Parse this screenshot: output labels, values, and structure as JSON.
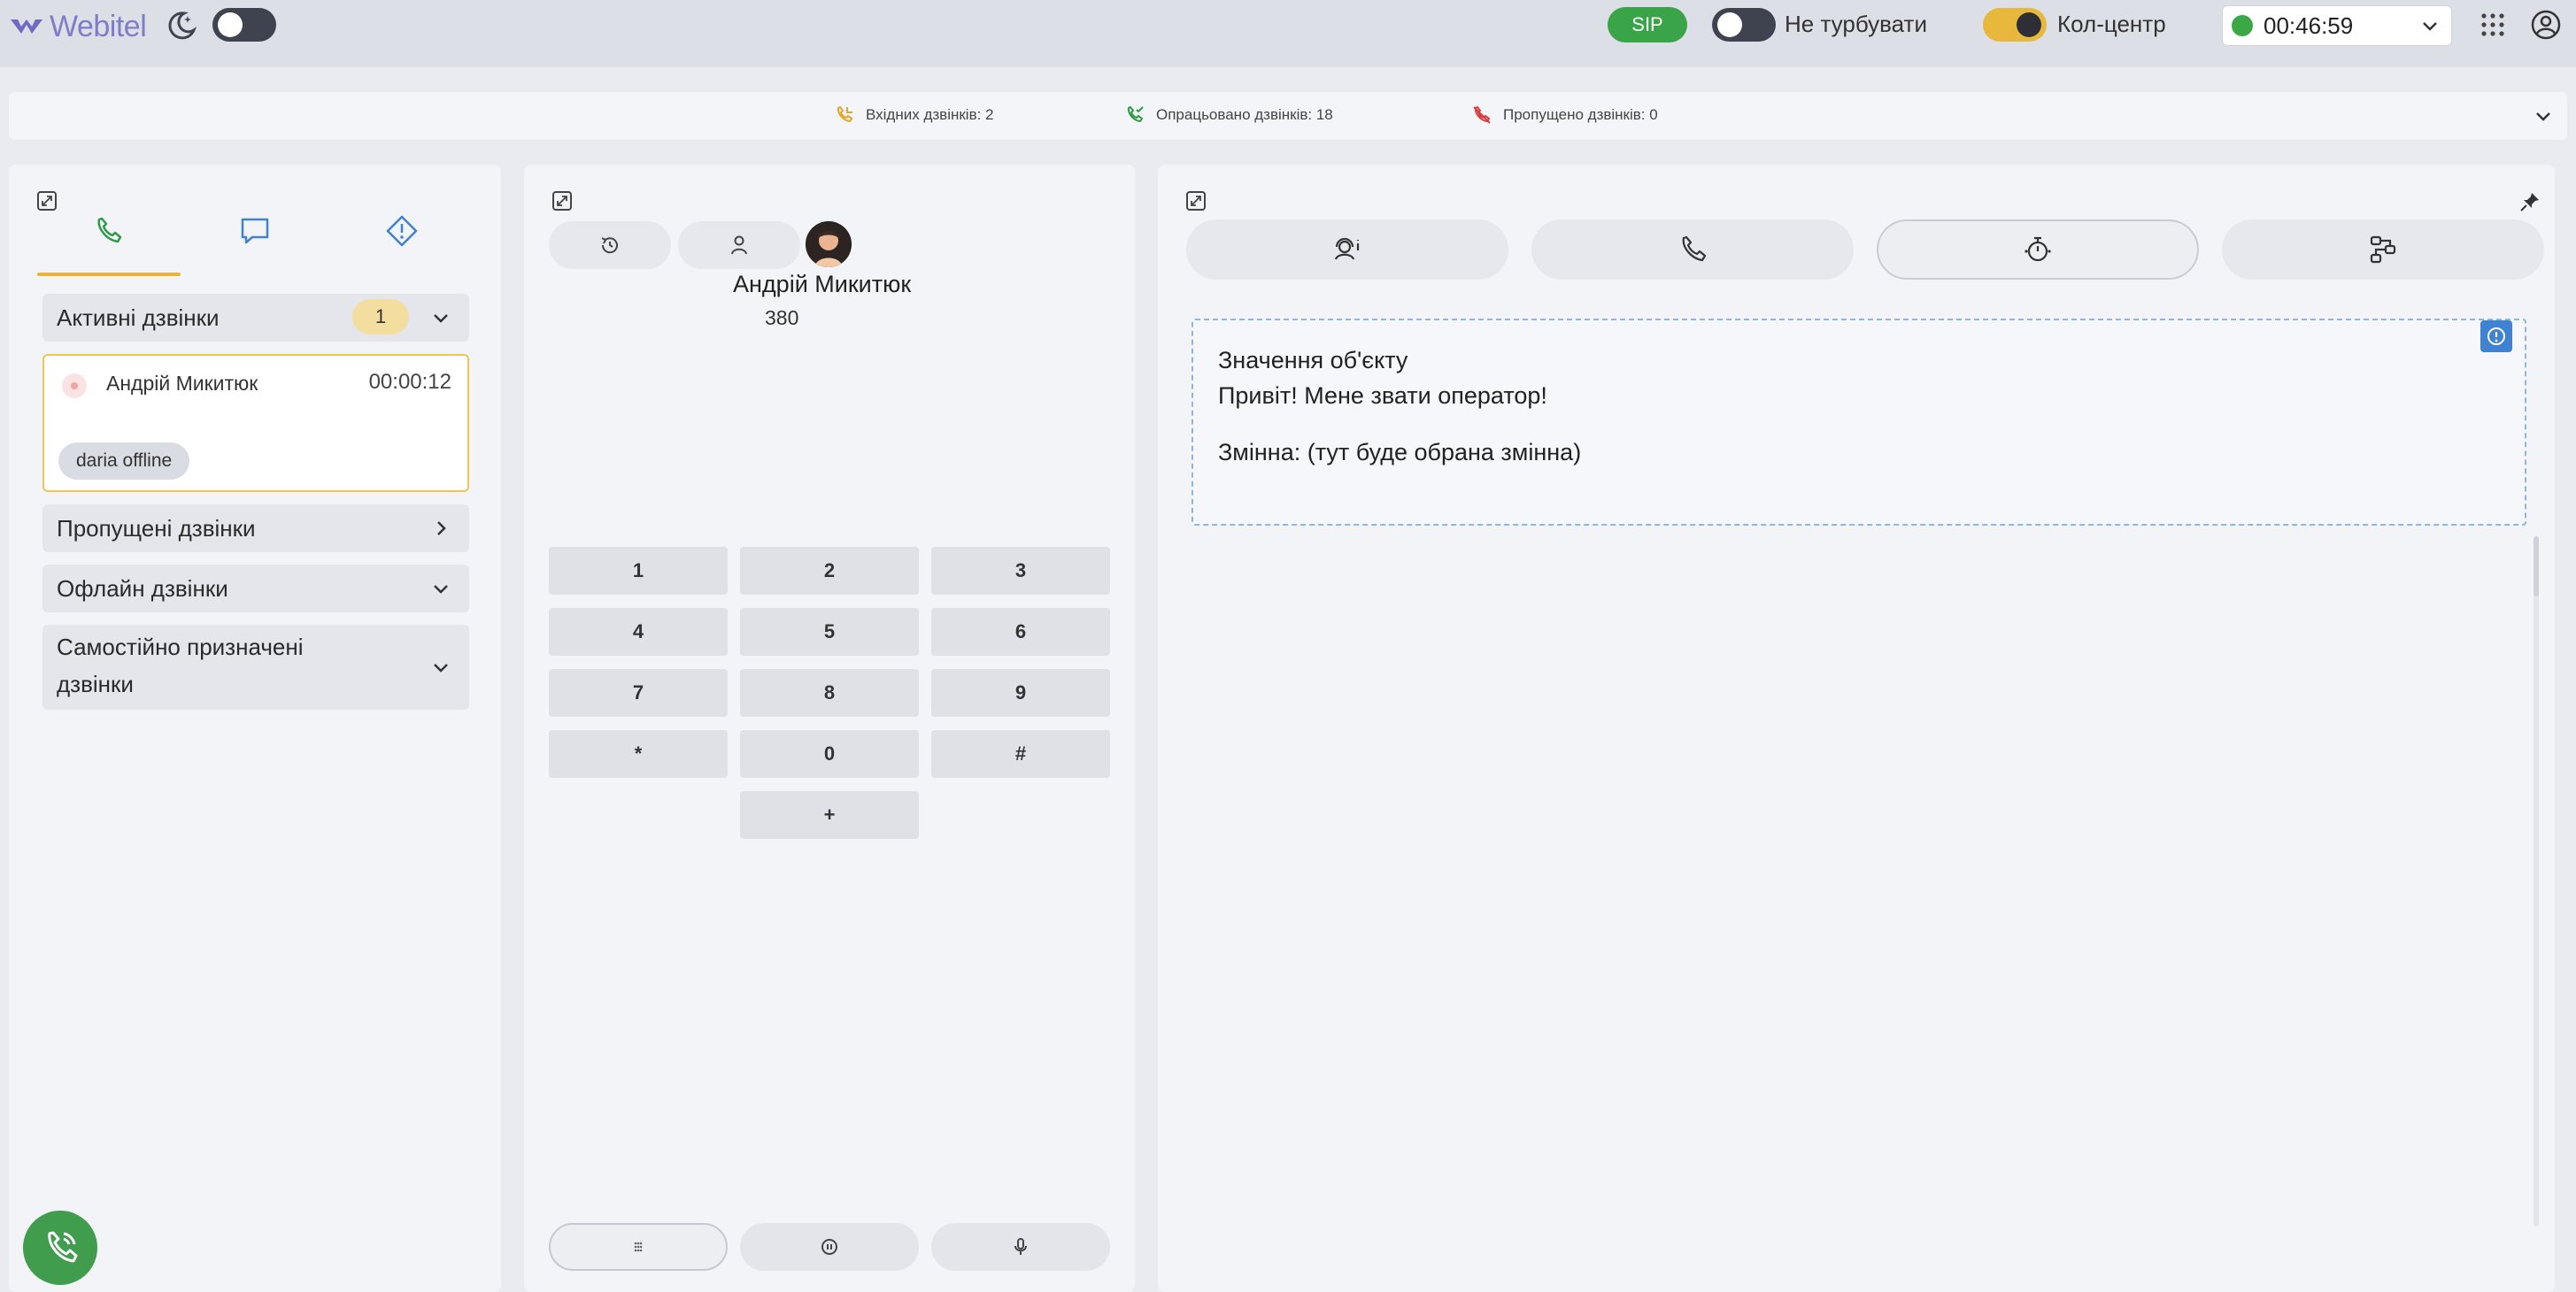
{
  "header": {
    "logo_text": "Webitel",
    "sip_label": "SIP",
    "dnd_label": "Не турбувати",
    "callcenter_label": "Кол-центр",
    "status_time": "00:46:59",
    "status_color": "#39a845"
  },
  "stats": {
    "incoming": "Вхідних дзвінків: 2",
    "handled": "Опрацьовано дзвінків: 18",
    "missed": "Пропущено дзвінків: 0"
  },
  "left": {
    "tabs": [
      "phone-icon",
      "chat-icon",
      "alert-icon"
    ],
    "active_section": {
      "title": "Активні дзвінки",
      "count": "1"
    },
    "active_call": {
      "name": "Андрій Микитюк",
      "duration": "00:00:12",
      "chip": "daria offline"
    },
    "sections": [
      {
        "title": "Пропущені дзвінки"
      },
      {
        "title": "Офлайн дзвінки"
      },
      {
        "title_line1": "Самостійно призначені",
        "title_line2": "дзвінки"
      }
    ]
  },
  "middle": {
    "contact_name": "Андрій Микитюк",
    "contact_number": "380",
    "keys": [
      "1",
      "2",
      "3",
      "4",
      "5",
      "6",
      "7",
      "8",
      "9",
      "*",
      "0",
      "#",
      "+"
    ],
    "controls": [
      "keypad-icon",
      "hold-icon",
      "mic-icon"
    ]
  },
  "right": {
    "tabs": [
      "agent-info-icon",
      "phone-icon",
      "timer-icon",
      "flow-icon"
    ],
    "script": {
      "line1": "Значення об'єкту",
      "line2": "Привіт! Мене звати оператор!",
      "line3": "Змінна: (тут буде обрана змінна)"
    }
  }
}
